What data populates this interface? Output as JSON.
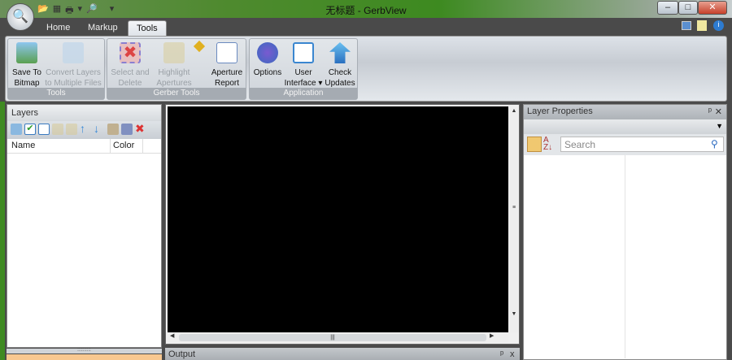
{
  "window": {
    "title": "无标题 - GerbView",
    "minimize": "–",
    "maximize": "□",
    "close": "✕"
  },
  "qat": [
    "open-icon",
    "new-icon",
    "print-icon",
    "▾",
    "preview-icon",
    "▾"
  ],
  "tabs": [
    {
      "label": "Home"
    },
    {
      "label": "Markup"
    },
    {
      "label": "Tools",
      "active": true
    }
  ],
  "ribbon": {
    "groups": [
      {
        "label": "Tools",
        "buttons": [
          {
            "l1": "Save To",
            "l2": "Bitmap"
          },
          {
            "l1": "Convert Layers",
            "l2": "to Multiple Files"
          }
        ]
      },
      {
        "label": "Gerber Tools",
        "buttons": [
          {
            "l1": "Select and",
            "l2": "Delete"
          },
          {
            "l1": "Highlight",
            "l2": "Apertures"
          },
          {
            "l1": "Aperture",
            "l2": "Report"
          }
        ]
      },
      {
        "label": "Application",
        "buttons": [
          {
            "l1": "Options",
            "l2": ""
          },
          {
            "l1": "User",
            "l2": "Interface ▾"
          },
          {
            "l1": "Check",
            "l2": "Updates"
          }
        ]
      }
    ]
  },
  "layers": {
    "title": "Layers",
    "columns": [
      "Name",
      "Color"
    ]
  },
  "output": {
    "title": "Output",
    "pin": "📌",
    "close": "x"
  },
  "properties": {
    "title": "Layer Properties",
    "pin": "ᵖ",
    "close": "✕",
    "search_placeholder": "Search"
  },
  "colors": {
    "accent": "#4a4a4a",
    "canvas": "#000000"
  }
}
